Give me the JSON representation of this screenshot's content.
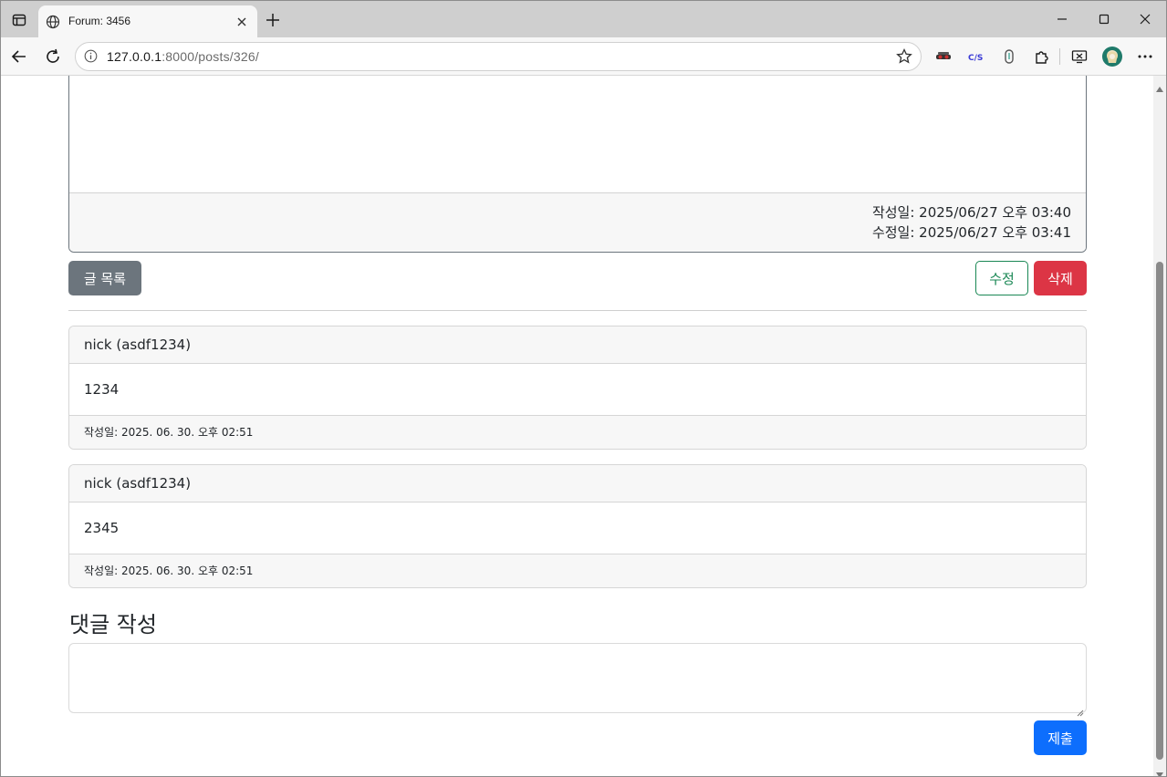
{
  "browser": {
    "tab_title": "Forum: 3456",
    "url_host": "127.0.0.1",
    "url_rest": ":8000/posts/326/"
  },
  "post": {
    "created_line": "작성일: 2025/06/27 오후 03:40",
    "modified_line": "수정일: 2025/06/27 오후 03:41"
  },
  "actions": {
    "list_label": "글 목록",
    "edit_label": "수정",
    "delete_label": "삭제"
  },
  "comments": [
    {
      "author": "nick (asdf1234)",
      "body": "1234",
      "date": "작성일: 2025. 06. 30. 오후 02:51"
    },
    {
      "author": "nick (asdf1234)",
      "body": "2345",
      "date": "작성일: 2025. 06. 30. 오후 02:51"
    }
  ],
  "reply": {
    "title": "댓글 작성",
    "value": "",
    "submit_label": "제출"
  },
  "colors": {
    "secondary": "#6c757d",
    "success": "#198754",
    "danger": "#dc3545",
    "primary": "#0d6efd"
  }
}
